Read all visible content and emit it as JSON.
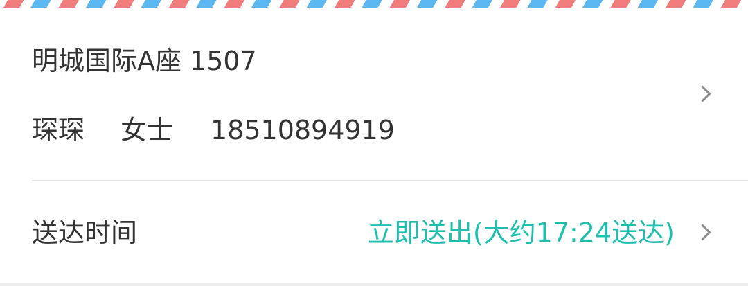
{
  "colors": {
    "stripe_red": "#f07c7c",
    "stripe_blue": "#5cb8f2",
    "accent_teal": "#1fbfb0",
    "text": "#333333",
    "chevron": "#8a8a8a"
  },
  "address": {
    "line": "明城国际A座  1507",
    "contact_name": "琛琛",
    "contact_title": "女士",
    "contact_phone": "18510894919",
    "chevron_icon": "chevron-right"
  },
  "delivery": {
    "label": "送达时间",
    "value": "立即送出(大约17:24送达)",
    "chevron_icon": "chevron-right"
  }
}
